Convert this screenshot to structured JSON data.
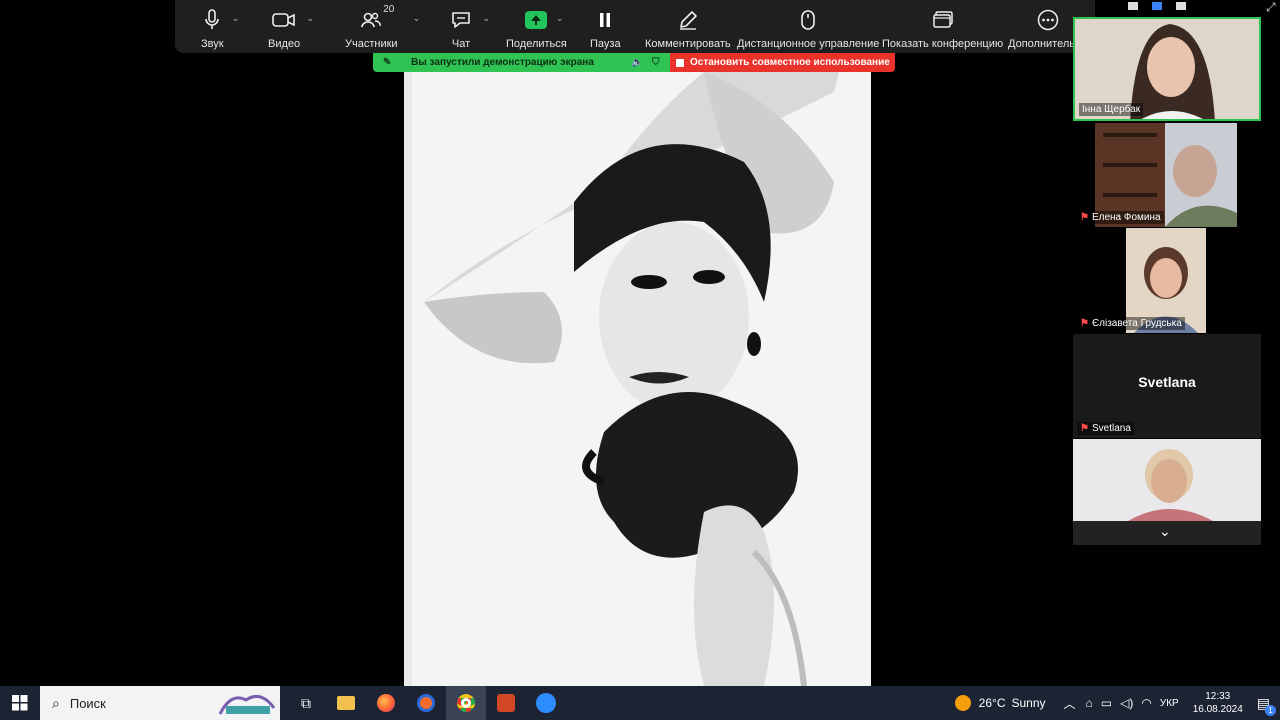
{
  "toolbar": {
    "audio": "Звук",
    "video": "Видео",
    "participants": "Участники",
    "participants_count": "20",
    "chat": "Чат",
    "share": "Поделиться",
    "pause": "Пауза",
    "annotate": "Комментировать",
    "remote_control": "Дистанционное управление",
    "show_conference": "Показать конференцию",
    "more": "Дополнительно"
  },
  "banner": {
    "sharing_message": "Вы запустили демонстрацию экрана",
    "stop_sharing": "Остановить совместное использование"
  },
  "gallery": {
    "tiles": [
      {
        "name": "Інна Щербак",
        "muted": false
      },
      {
        "name": "Елена Фомина",
        "muted": true
      },
      {
        "name": "Єлізавета Грудська",
        "muted": true
      },
      {
        "name": "Svetlana",
        "muted": true,
        "placeholder": "Svetlana"
      },
      {
        "name": "",
        "muted": false
      }
    ]
  },
  "taskbar": {
    "search_placeholder": "Поиск",
    "weather_temp": "26°C",
    "weather_desc": "Sunny",
    "language": "УКР",
    "time": "12:33",
    "date": "16.08.2024",
    "notification_count": "1"
  },
  "colors": {
    "toolbar_bg": "#1f1f1f",
    "banner_green": "#2ec352",
    "banner_red": "#e8322a",
    "active_speaker_border": "#2ec352",
    "taskbar_bg": "#1c2333"
  }
}
